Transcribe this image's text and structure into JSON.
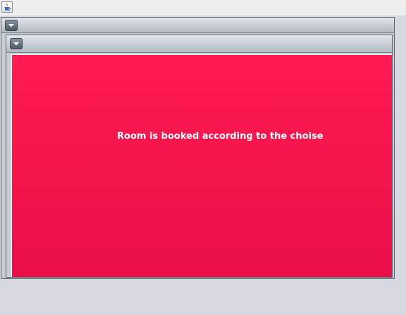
{
  "window": {
    "icon": "java-cup-icon",
    "outer_menu_icon": "chevron-down-icon",
    "inner_menu_icon": "chevron-down-icon"
  },
  "content": {
    "message": "Room is booked according to the choise",
    "background_color": "#ee1249",
    "text_color": "#ffffff"
  }
}
